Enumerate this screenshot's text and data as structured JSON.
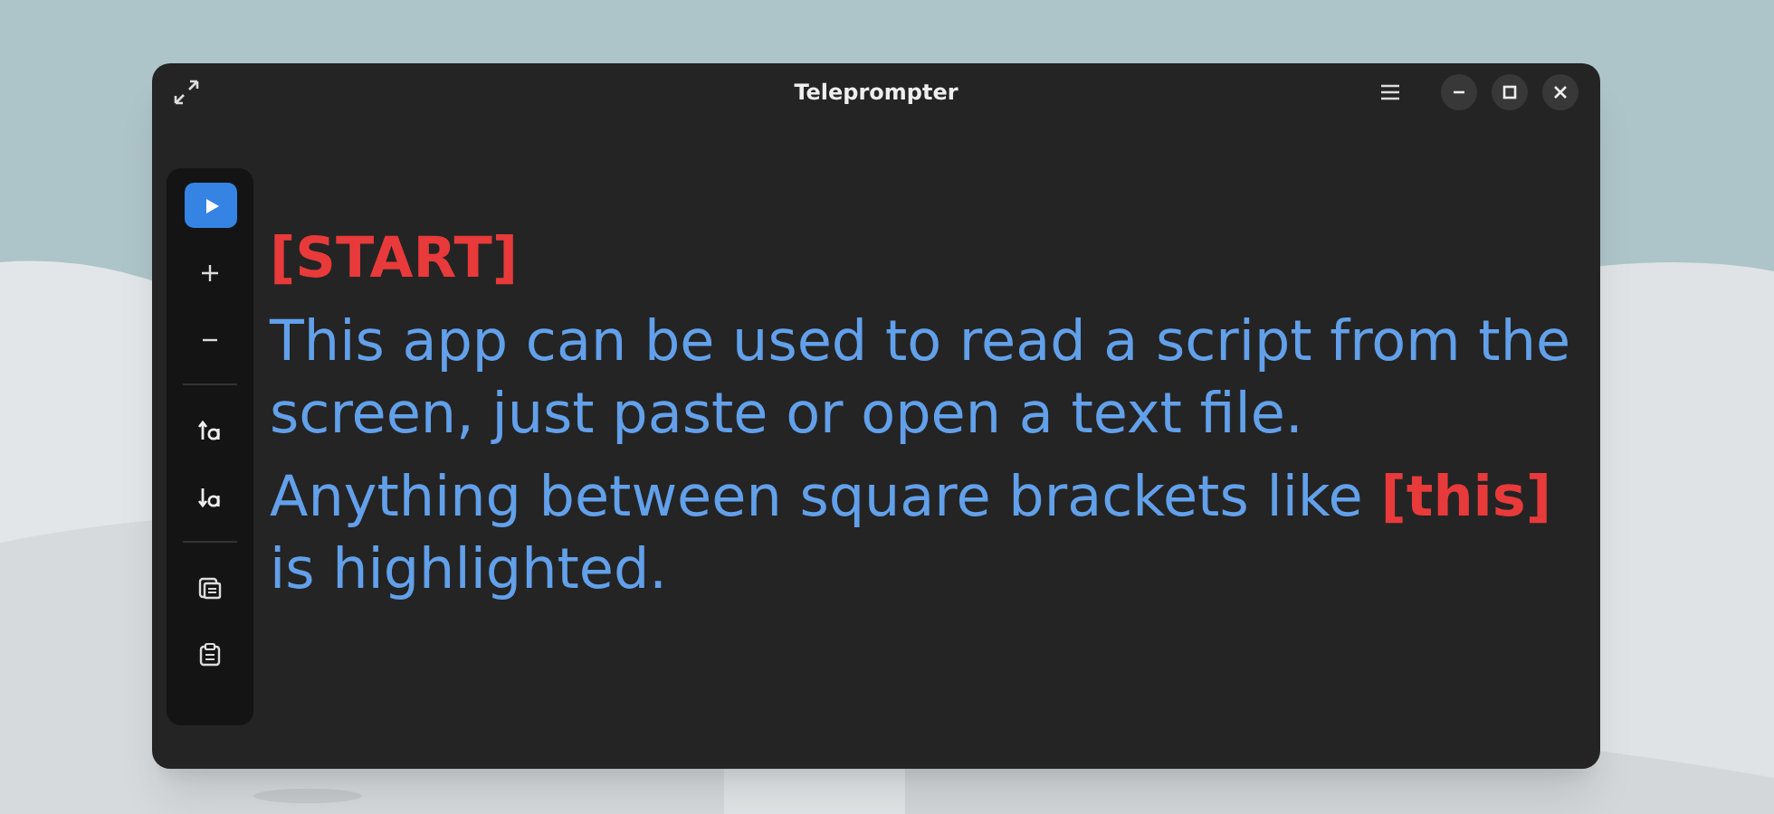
{
  "window": {
    "title": "Teleprompter"
  },
  "toolbar": [
    {
      "kind": "play",
      "highlighted": true
    },
    {
      "kind": "increase",
      "highlighted": false
    },
    {
      "kind": "decrease",
      "highlighted": false
    },
    {
      "kind": "separator"
    },
    {
      "kind": "raise",
      "highlighted": false
    },
    {
      "kind": "lower",
      "highlighted": false
    },
    {
      "kind": "separator"
    },
    {
      "kind": "open",
      "highlighted": false
    },
    {
      "kind": "paste",
      "highlighted": false
    }
  ],
  "script": [
    {
      "segments": [
        {
          "text": "[START]",
          "highlight": true
        }
      ]
    },
    {
      "segments": [
        {
          "text": "This app can be used to read a script from the screen, just paste or open a text file.",
          "highlight": false
        }
      ]
    },
    {
      "segments": [
        {
          "text": "Anything between square brackets like ",
          "highlight": false
        },
        {
          "text": "[this]",
          "highlight": true
        },
        {
          "text": " is highlighted.",
          "highlight": false
        }
      ]
    }
  ]
}
